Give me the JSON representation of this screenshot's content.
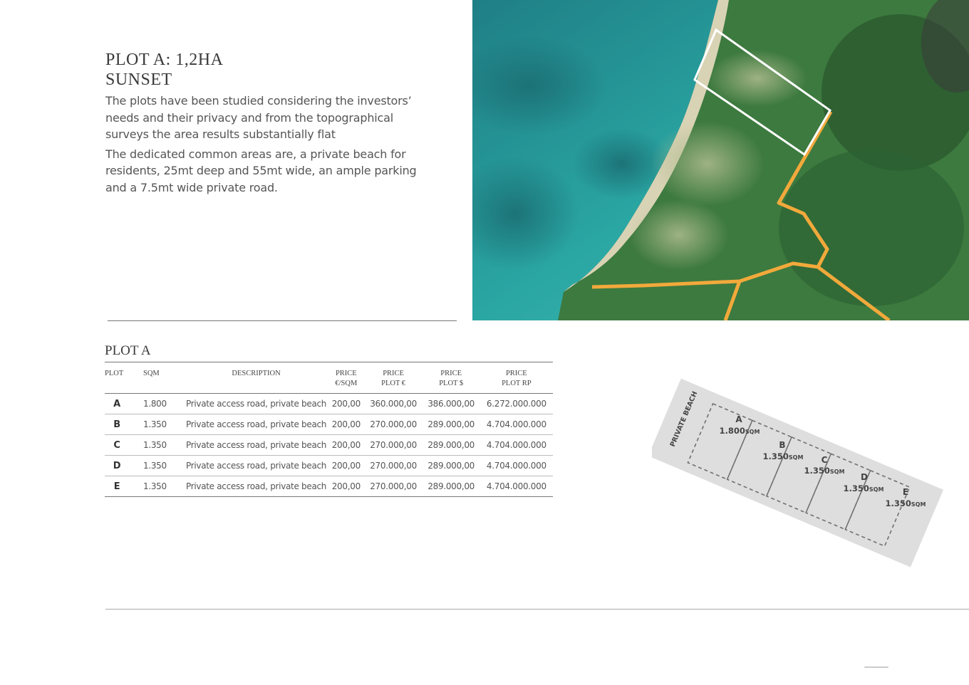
{
  "header": {
    "title_line1": "PLOT A: 1,2HA",
    "title_line2": "SUNSET"
  },
  "intro": {
    "paragraph1": "The plots have been studied considering the investors’ needs and their privacy and from the topographical surveys the area results substantially flat",
    "paragraph2": "The dedicated common areas are, a private beach for residents, 25mt deep and 55mt wide, an ample parking and a 7.5mt wide private road."
  },
  "table": {
    "title": "PLOT A",
    "headers": {
      "plot": "PLOT",
      "sqm": "SQM",
      "description": "DESCRIPTION",
      "price_sqm_1": "PRICE",
      "price_sqm_2": "€/SQM",
      "price_plot_eur_1": "PRICE",
      "price_plot_eur_2": "PLOT €",
      "price_plot_usd_1": "PRICE",
      "price_plot_usd_2": "PLOT $",
      "price_plot_rp_1": "PRICE",
      "price_plot_rp_2": "PLOT RP"
    },
    "rows": [
      {
        "plot": "A",
        "sqm": "1.800",
        "description": "Private access road, private beach",
        "price_sqm": "200,00",
        "price_eur": "360.000,00",
        "price_usd": "386.000,00",
        "price_rp": "6.272.000.000"
      },
      {
        "plot": "B",
        "sqm": "1.350",
        "description": "Private access road, private beach",
        "price_sqm": "200,00",
        "price_eur": "270.000,00",
        "price_usd": "289.000,00",
        "price_rp": "4.704.000.000"
      },
      {
        "plot": "C",
        "sqm": "1.350",
        "description": "Private access road, private beach",
        "price_sqm": "200,00",
        "price_eur": "270.000,00",
        "price_usd": "289.000,00",
        "price_rp": "4.704.000.000"
      },
      {
        "plot": "D",
        "sqm": "1.350",
        "description": "Private access road, private beach",
        "price_sqm": "200,00",
        "price_eur": "270.000,00",
        "price_usd": "289.000,00",
        "price_rp": "4.704.000.000"
      },
      {
        "plot": "E",
        "sqm": "1.350",
        "description": "Private access road, private beach",
        "price_sqm": "200,00",
        "price_eur": "270.000,00",
        "price_usd": "289.000,00",
        "price_rp": "4.704.000.000"
      }
    ]
  },
  "plan": {
    "beach_label": "PRIVATE BEACH",
    "plots": [
      {
        "letter": "A",
        "area": "1.800",
        "unit": "SQM"
      },
      {
        "letter": "B",
        "area": "1.350",
        "unit": "SQM"
      },
      {
        "letter": "C",
        "area": "1.350",
        "unit": "SQM"
      },
      {
        "letter": "D",
        "area": "1.350",
        "unit": "SQM"
      },
      {
        "letter": "E",
        "area": "1.350",
        "unit": "SQM"
      }
    ]
  },
  "colors": {
    "road": "#f2a93b",
    "plot_outline": "#ffffff",
    "sea": "#2fa9a6",
    "forest": "#2f6b3a",
    "plan_fill": "#dedede"
  }
}
